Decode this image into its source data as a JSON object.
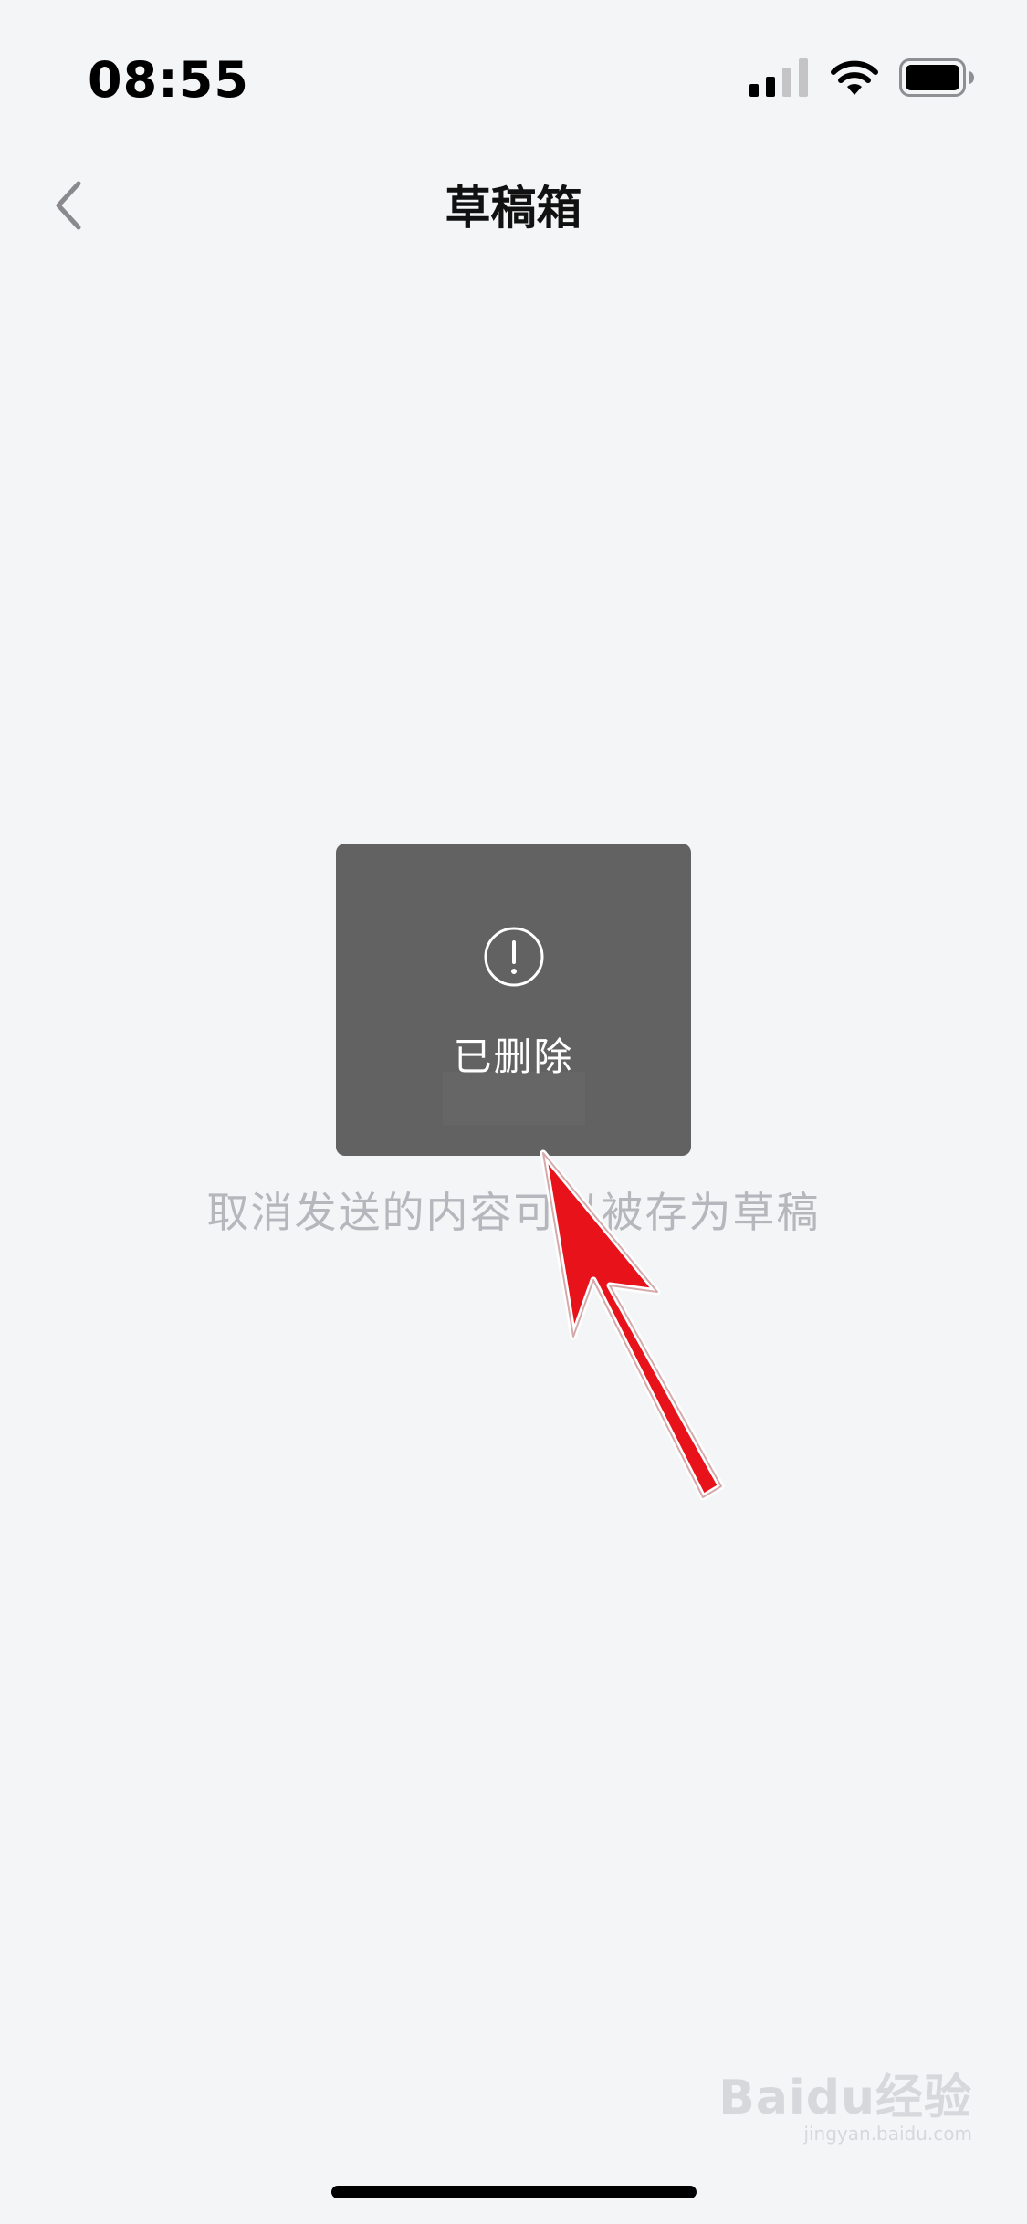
{
  "status_bar": {
    "time": "08:55",
    "icons": [
      "signal-icon",
      "wifi-icon",
      "battery-icon"
    ]
  },
  "nav": {
    "title": "草稿箱",
    "back_icon": "chevron-left-icon"
  },
  "empty_state": {
    "hint": "取消发送的内容可以被存为草稿"
  },
  "toast": {
    "icon": "exclamation-circle-icon",
    "message": "已删除"
  },
  "annotation": {
    "arrow_color": "#e8121b",
    "icon": "red-arrow-annotation"
  },
  "watermark": {
    "logo": "Baidu经验",
    "url": "jingyan.baidu.com"
  },
  "colors": {
    "background": "#f4f5f7",
    "toast_bg": "#626262",
    "hint_text": "#b5b7bc"
  }
}
